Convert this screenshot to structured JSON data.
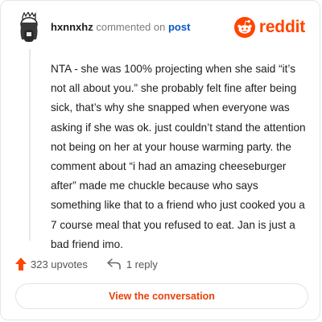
{
  "header": {
    "username": "hxnnxhz",
    "action_text": "commented on",
    "link_text": "post",
    "brand_text": "reddit",
    "avatar_icon": "snoo-avatar",
    "logo_icon": "reddit-snoo-logo"
  },
  "comment": {
    "body": "NTA - she was 100% projecting when she said “it’s not all about you.” she probably felt fine after being sick, that’s why she snapped when everyone was asking if she was ok. just couldn’t stand the attention not being on her at your house warming party. the comment about “i had an amazing cheeseburger after” made me chuckle because who says something like that to a friend who just cooked you a 7 course meal that you refused to eat. Jan is just a bad friend imo."
  },
  "actions": {
    "upvotes": "323 upvotes",
    "replies": "1 reply",
    "upvote_icon": "upvote-arrow-icon",
    "reply_icon": "reply-arrow-icon"
  },
  "footer": {
    "button_label": "View the conversation"
  },
  "colors": {
    "brand": "#ff4500",
    "link": "#0a56c7",
    "button_text": "#e8410a"
  }
}
